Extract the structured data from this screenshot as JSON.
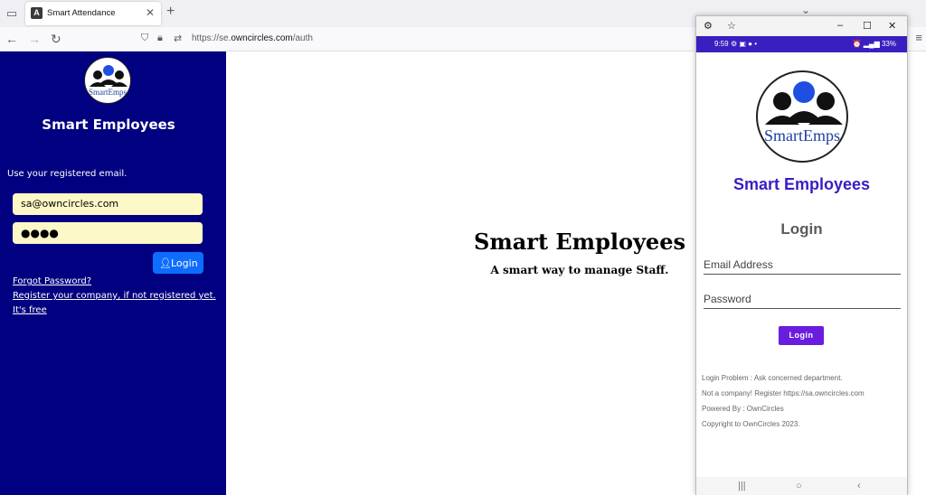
{
  "browser": {
    "tab_title": "Smart Attendance",
    "url_prefix": "https://se.",
    "url_host": "owncircles.com",
    "url_path": "/auth"
  },
  "sidebar": {
    "logo_text": "SmartEmps",
    "title": "Smart Employees",
    "hint": "Use your registered email.",
    "email_value": "sa@owncircles.com",
    "password_value": "●●●●",
    "login_label": "Login",
    "forgot_link": "Forgot Password?",
    "register_link": "Register your company, if not registered yet.",
    "free_link": "It's free"
  },
  "hero": {
    "title": "Smart Employees",
    "subtitle": "A smart way to manage Staff."
  },
  "phone": {
    "status_time": "9:59",
    "status_battery": "33%",
    "logo_text": "SmartEmps",
    "app_title": "Smart Employees",
    "login_heading": "Login",
    "email_placeholder": "Email Address",
    "password_placeholder": "Password",
    "login_button": "Login",
    "notes": [
      "Login Problem : Ask concerned department.",
      "Not a company! Register https://sa.owncircles.com",
      "Powered By : OwnCircles",
      "Copyright to OwnCircles 2023."
    ]
  },
  "colors": {
    "sidebar_bg": "#000080",
    "input_bg": "#fdf8c8",
    "login_btn": "#0d6efd",
    "phone_accent": "#3b1cc4",
    "phone_btn": "#6a1ddf"
  },
  "icons": [
    "tab-list-icon",
    "angular-favicon-icon",
    "close-icon",
    "new-tab-icon",
    "back-icon",
    "forward-icon",
    "reload-icon",
    "shield-icon",
    "lock-icon",
    "permissions-icon",
    "menu-icon",
    "user-icon",
    "settings-icon",
    "pin-icon",
    "minimize-icon",
    "maximize-icon",
    "window-close-icon"
  ]
}
